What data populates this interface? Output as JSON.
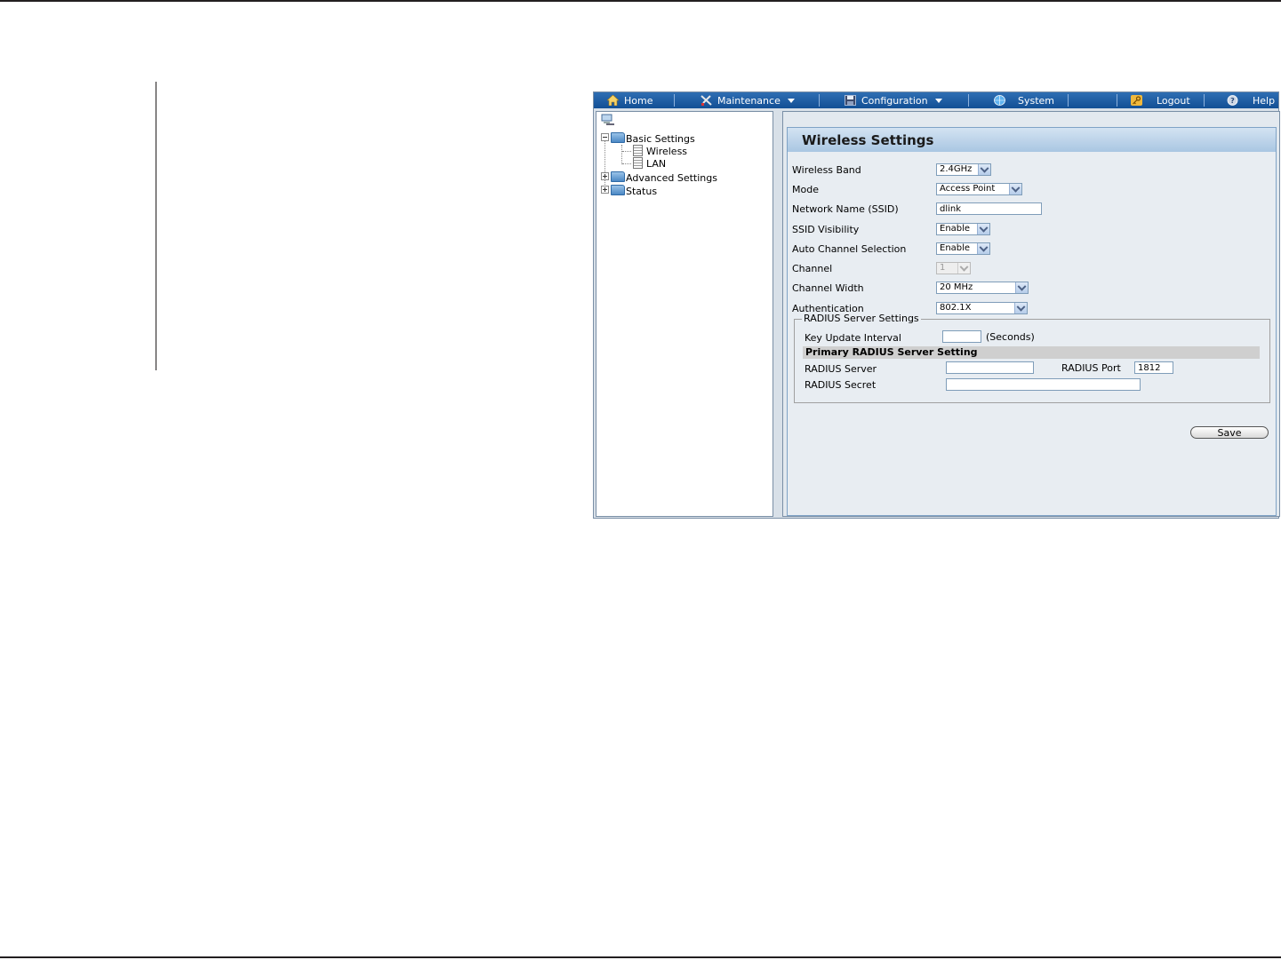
{
  "menubar": {
    "home": "Home",
    "maintenance": "Maintenance",
    "configuration": "Configuration",
    "system": "System",
    "logout": "Logout",
    "help": "Help"
  },
  "tree": {
    "basic_settings": "Basic Settings",
    "wireless": "Wireless",
    "lan": "LAN",
    "advanced_settings": "Advanced Settings",
    "status": "Status"
  },
  "panel": {
    "title": "Wireless Settings",
    "fields": {
      "wireless_band": {
        "label": "Wireless Band",
        "value": "2.4GHz"
      },
      "mode": {
        "label": "Mode",
        "value": "Access Point"
      },
      "ssid": {
        "label": "Network Name (SSID)",
        "value": "dlink"
      },
      "ssid_visibility": {
        "label": "SSID Visibility",
        "value": "Enable"
      },
      "auto_channel": {
        "label": "Auto Channel Selection",
        "value": "Enable"
      },
      "channel": {
        "label": "Channel",
        "value": "1"
      },
      "channel_width": {
        "label": "Channel Width",
        "value": "20 MHz"
      },
      "authentication": {
        "label": "Authentication",
        "value": "802.1X"
      }
    },
    "radius": {
      "legend": "RADIUS Server Settings",
      "key_update_label": "Key Update Interval",
      "key_update_value": "",
      "key_update_unit": "(Seconds)",
      "primary_heading": "Primary RADIUS Server Setting",
      "server_label": "RADIUS Server",
      "server_value": "",
      "port_label": "RADIUS Port",
      "port_value": "1812",
      "secret_label": "RADIUS Secret",
      "secret_value": ""
    },
    "save_label": "Save"
  }
}
